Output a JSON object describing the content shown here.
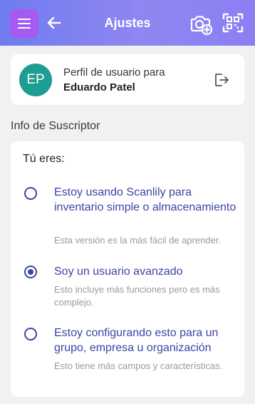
{
  "header": {
    "title": "Ajustes",
    "menu_icon": "menu-icon",
    "back_icon": "arrow-left-icon",
    "camera_icon": "camera-plus-icon",
    "scan_icon": "qr-scan-icon",
    "colors": {
      "gradient_start": "#6f7cf0",
      "gradient_end": "#8b7ff3",
      "menu_bg": "#a55af2"
    }
  },
  "profile": {
    "initials": "EP",
    "line1": "Perfil de usuario para",
    "name": "Eduardo Patel",
    "logout_icon": "logout-icon",
    "avatar_color": "#1e9d92"
  },
  "subscriber": {
    "section_title": "Info de Suscriptor",
    "prompt": "Tú eres:",
    "accent_color": "#3d44a8",
    "options": [
      {
        "label": "Estoy usando Scanlily para inventario simple o almacenamiento",
        "description": "Esta versión es la más fácil de aprender.",
        "selected": false
      },
      {
        "label": "Soy un usuario avanzado",
        "description": "Esto incluye más funciones pero es más complejo.",
        "selected": true
      },
      {
        "label": "Estoy configurando esto para un grupo, empresa u organización",
        "description": "Esto tiene más campos y características.",
        "selected": false
      }
    ]
  }
}
